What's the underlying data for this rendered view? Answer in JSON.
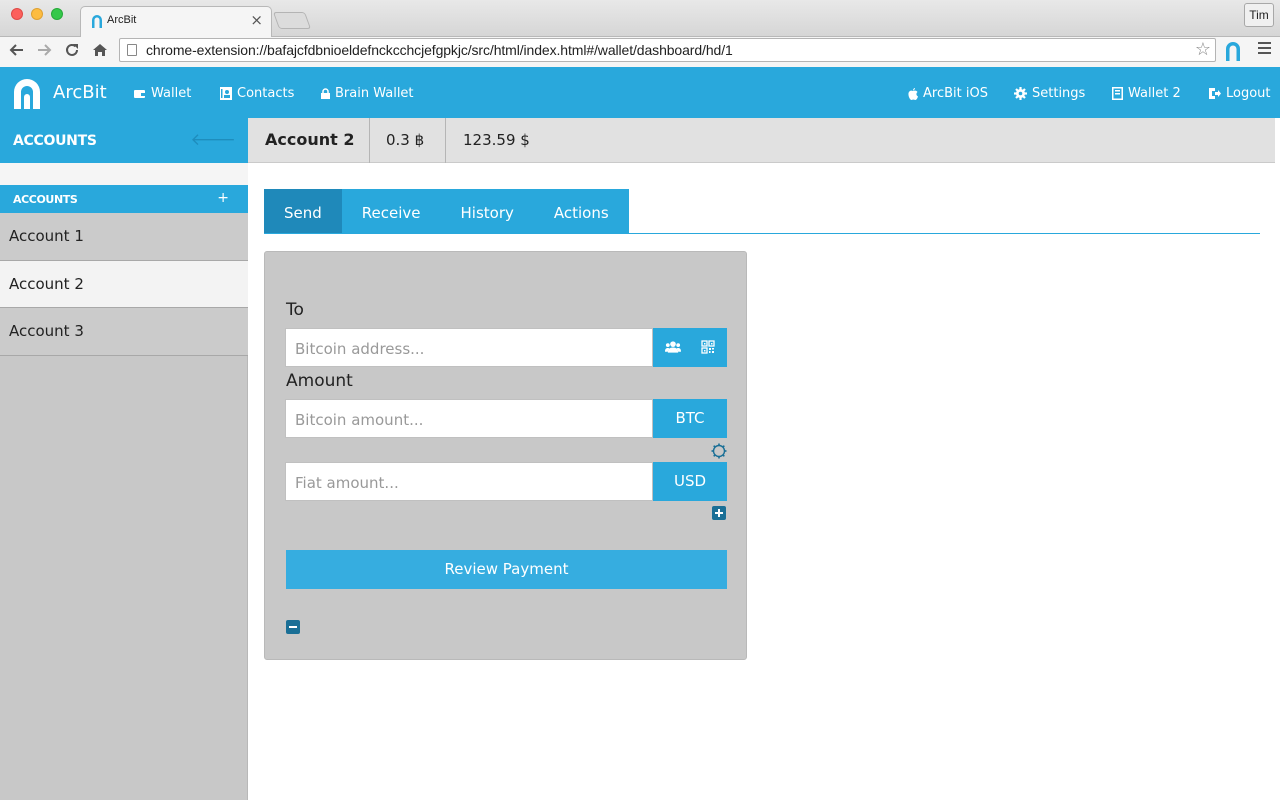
{
  "browser": {
    "tab_title": "ArcBit",
    "tab_close": "×",
    "profile_name": "Tim",
    "url": "chrome-extension://bafajcfdbnioeldefnckcchcjefgpkjc/src/html/index.html#/wallet/dashboard/hd/1"
  },
  "header": {
    "brand": "ArcBit",
    "nav_left": [
      {
        "label": "Wallet",
        "icon": "wallet-icon"
      },
      {
        "label": "Contacts",
        "icon": "contacts-icon"
      },
      {
        "label": "Brain Wallet",
        "icon": "lock-icon"
      }
    ],
    "nav_right": [
      {
        "label": "ArcBit iOS",
        "icon": "apple-icon"
      },
      {
        "label": "Settings",
        "icon": "gear-icon"
      },
      {
        "label": "Wallet 2",
        "icon": "wallet-book-icon"
      },
      {
        "label": "Logout",
        "icon": "logout-icon"
      }
    ]
  },
  "sidebar": {
    "title": "ACCOUNTS",
    "section_title": "ACCOUNTS",
    "add_label": "+",
    "accounts": [
      {
        "label": "Account 1"
      },
      {
        "label": "Account 2"
      },
      {
        "label": "Account 3"
      }
    ],
    "active_index": 1
  },
  "account_bar": {
    "name": "Account 2",
    "btc_balance": "0.3 ฿",
    "fiat_balance": "123.59 $"
  },
  "tabs": [
    {
      "label": "Send",
      "active": true
    },
    {
      "label": "Receive",
      "active": false
    },
    {
      "label": "History",
      "active": false
    },
    {
      "label": "Actions",
      "active": false
    }
  ],
  "send_form": {
    "to_label": "To",
    "address_placeholder": "Bitcoin address...",
    "amount_label": "Amount",
    "btc_placeholder": "Bitcoin amount...",
    "btc_unit": "BTC",
    "fiat_placeholder": "Fiat amount...",
    "fiat_unit": "USD",
    "review_button": "Review Payment"
  },
  "colors": {
    "accent": "#29a8dc",
    "accent_dark": "#1f89ba",
    "panel": "#c8c8c8"
  }
}
